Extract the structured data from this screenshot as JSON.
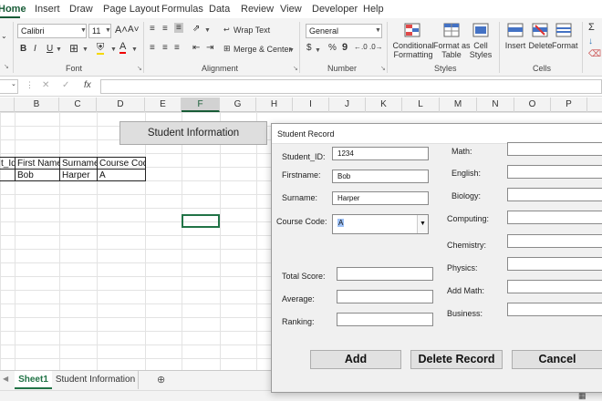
{
  "ribbon": {
    "tabs": [
      "Home",
      "Insert",
      "Draw",
      "Page Layout",
      "Formulas",
      "Data",
      "Review",
      "View",
      "Developer",
      "Help"
    ],
    "font": {
      "name": "Calibri",
      "size": "11",
      "grow": "A˄",
      "shrink": "A˅",
      "bold": "B",
      "italic": "I",
      "underline": "U",
      "font_color": "A"
    },
    "alignment": {
      "wrap_text": "Wrap Text",
      "merge_center": "Merge & Center"
    },
    "number": {
      "format": "General",
      "currency": "$",
      "percent": "%",
      "comma": "9"
    },
    "styles": {
      "conditional": "Conditional\nFormatting",
      "format_table": "Format as\nTable",
      "cell_styles": "Cell\nStyles"
    },
    "cells": {
      "insert": "Insert",
      "delete": "Delete",
      "format": "Format"
    },
    "editing": {
      "sum": "Σ"
    },
    "groups": {
      "font": "Font",
      "alignment": "Alignment",
      "number": "Number",
      "styles": "Styles",
      "cells": "Cells"
    }
  },
  "formula_bar": {
    "cancel": "✕",
    "enter": "✓",
    "fx": "fx"
  },
  "grid": {
    "columns": [
      "B",
      "C",
      "D",
      "E",
      "F",
      "G",
      "H",
      "I",
      "J",
      "K",
      "L",
      "M",
      "N",
      "O",
      "P"
    ],
    "selected_column": "F",
    "header_row": [
      "t_Id",
      "First Name",
      "Surname",
      "Course Code"
    ],
    "data_row": [
      "Bob",
      "Harper",
      "A"
    ]
  },
  "sheet_button": "Student Information",
  "sheets": [
    "Sheet1",
    "Student Information"
  ],
  "dialog": {
    "title": "Student Record",
    "left_fields": [
      {
        "label": "Student_ID:",
        "value": "1234"
      },
      {
        "label": "Firstname:",
        "value": "Bob"
      },
      {
        "label": "Surname:",
        "value": "Harper"
      },
      {
        "label": "Course Code:",
        "value": "A"
      }
    ],
    "score_fields": [
      {
        "label": "Total Score:",
        "value": ""
      },
      {
        "label": "Average:",
        "value": ""
      },
      {
        "label": "Ranking:",
        "value": ""
      }
    ],
    "subject_fields": [
      {
        "label": "Math:",
        "value": ""
      },
      {
        "label": "English:",
        "value": ""
      },
      {
        "label": "Biology:",
        "value": ""
      },
      {
        "label": "Computing:",
        "value": ""
      },
      {
        "label": "Chemistry:",
        "value": ""
      },
      {
        "label": "Physics:",
        "value": ""
      },
      {
        "label": "Add Math:",
        "value": ""
      },
      {
        "label": "Business:",
        "value": ""
      }
    ],
    "buttons": {
      "add": "Add",
      "delete": "Delete Record",
      "cancel": "Cancel"
    }
  },
  "colors": {
    "accent": "#217346",
    "tab_accent": "#185c37"
  }
}
